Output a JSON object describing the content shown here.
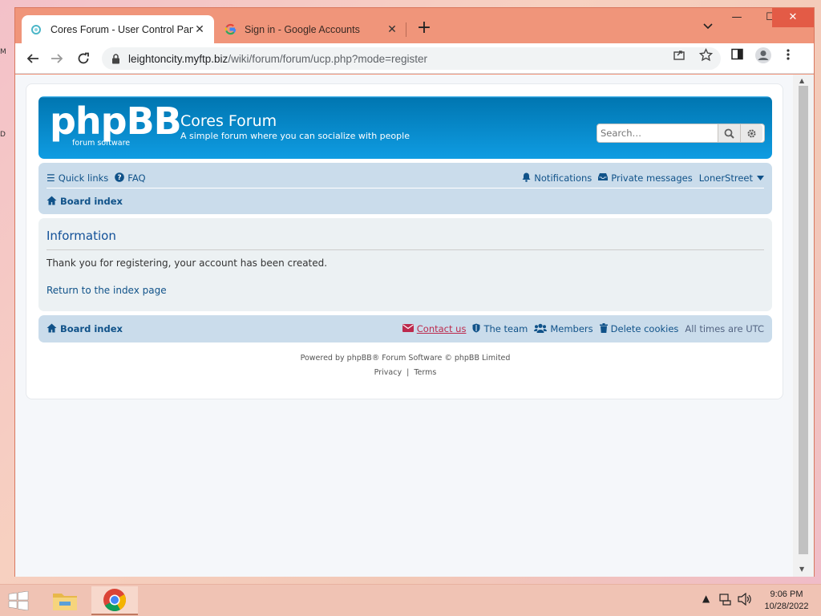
{
  "browser": {
    "tabs": [
      {
        "title": "Cores Forum - User Control Panel",
        "active": true
      },
      {
        "title": "Sign in - Google Accounts",
        "active": false
      }
    ],
    "url_host": "leightoncity.myftp.biz",
    "url_path": "/wiki/forum/forum/ucp.php?mode=register"
  },
  "forum": {
    "logo_text": "phpBB",
    "logo_sub": "forum software",
    "site_title": "Cores Forum",
    "site_description": "A simple forum where you can socialize with people",
    "search_placeholder": "Search…",
    "nav": {
      "quick_links": "Quick links",
      "faq": "FAQ",
      "notifications": "Notifications",
      "private_messages": "Private messages",
      "username": "LonerStreet",
      "board_index": "Board index"
    },
    "panel": {
      "heading": "Information",
      "message": "Thank you for registering, your account has been created.",
      "return_link": "Return to the index page"
    },
    "footer_nav": {
      "board_index": "Board index",
      "contact_us": "Contact us",
      "the_team": "The team",
      "members": "Members",
      "delete_cookies": "Delete cookies",
      "timezone": "All times are UTC"
    },
    "copyright": {
      "powered_by": "Powered by phpBB® Forum Software © phpBB Limited",
      "privacy": "Privacy",
      "separator": "|",
      "terms": "Terms"
    }
  },
  "taskbar": {
    "time": "9:06 PM",
    "date": "10/28/2022"
  },
  "colors": {
    "header_blue": "#12a3eb",
    "navbar_bg": "#cadceb",
    "link_blue": "#105289",
    "contact_red": "#bc2a4d"
  }
}
